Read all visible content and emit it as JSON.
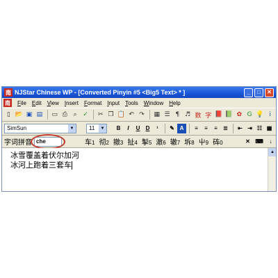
{
  "window": {
    "title": "NJStar Chinese WP - [Converted Pinyin #5 <Big5 Text> * ]",
    "app_icon_glyph": "南"
  },
  "menu": [
    {
      "u": "F",
      "rest": "ile"
    },
    {
      "u": "E",
      "rest": "dit"
    },
    {
      "u": "V",
      "rest": "iew"
    },
    {
      "u": "I",
      "rest": "nsert"
    },
    {
      "u": "F",
      "rest": "ormat"
    },
    {
      "u": "I",
      "rest": "nput"
    },
    {
      "u": "T",
      "rest": "ools"
    },
    {
      "u": "W",
      "rest": "indow"
    },
    {
      "u": "H",
      "rest": "elp"
    }
  ],
  "format": {
    "font": "SimSun",
    "size": "11",
    "bold": "B",
    "italic": "I",
    "underline": "U",
    "strike": "D",
    "highlight": "A"
  },
  "toolbar": {
    "chinese_label_1": "数",
    "chinese_label_2": "字"
  },
  "ime": {
    "label": "字词拼音",
    "input_value": "che",
    "candidates": [
      {
        "char": "车",
        "num": "1"
      },
      {
        "char": "彻",
        "num": "2"
      },
      {
        "char": "撤",
        "num": "3"
      },
      {
        "char": "扯",
        "num": "4"
      },
      {
        "char": "掣",
        "num": "5"
      },
      {
        "char": "澈",
        "num": "6"
      },
      {
        "char": "辙",
        "num": "7"
      },
      {
        "char": "坼",
        "num": "8"
      },
      {
        "char": "屮",
        "num": "9"
      },
      {
        "char": "砗",
        "num": "0"
      }
    ]
  },
  "document": {
    "line1": "冰雪覆盖着伏尔加河",
    "line2": "冰河上跑着三套车"
  },
  "colors": {
    "title_bar": "#1a55d6",
    "annotation_circle": "#c0392b"
  }
}
